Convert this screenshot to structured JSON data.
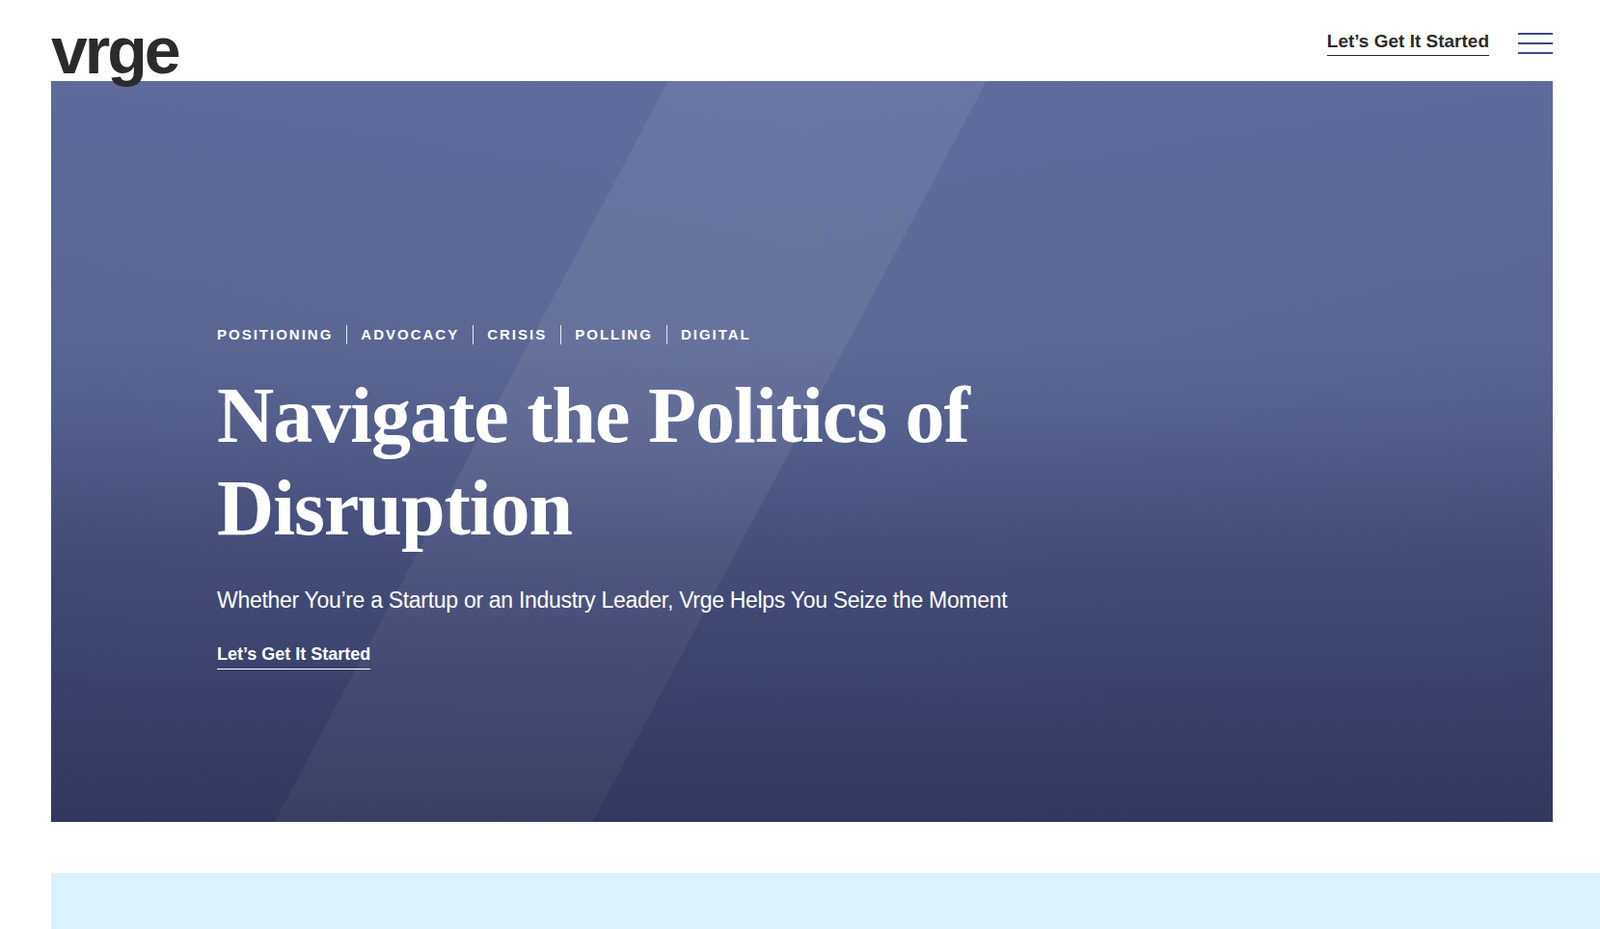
{
  "header": {
    "logo": "vrge",
    "cta": "Let’s Get It Started",
    "menu_open": false
  },
  "hero": {
    "tags": [
      "POSITIONING",
      "ADVOCACY",
      "CRISIS",
      "POLLING",
      "DIGITAL"
    ],
    "headline": "Navigate the Politics of Disruption",
    "subtitle": "Whether You’re a Startup or an Industry Leader, Vrge Helps You Seize the Moment",
    "cta": "Let’s Get It Started"
  }
}
